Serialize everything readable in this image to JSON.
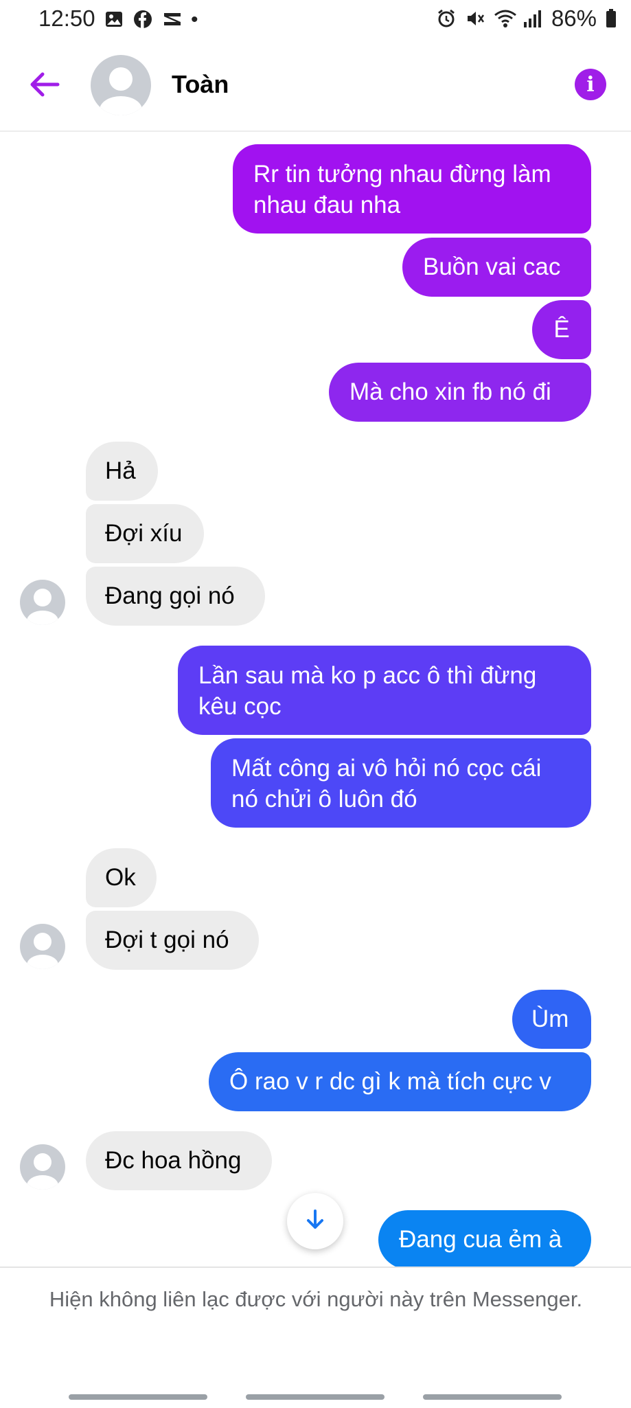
{
  "status_bar": {
    "time": "12:50",
    "battery": "86%",
    "icons": [
      "gallery-icon",
      "facebook-icon",
      "capcut-icon",
      "dot-icon",
      "alarm-icon",
      "mute-icon",
      "wifi-icon",
      "signal-icon",
      "battery-icon"
    ]
  },
  "header": {
    "contact_name": "Toàn",
    "info_glyph": "i",
    "accent_color": "#a01ee8"
  },
  "messages": [
    {
      "side": "out",
      "text": "Rr tin tưởng nhau đừng làm nhau đau nha",
      "color": "#a112f0"
    },
    {
      "side": "out",
      "text": "Buồn vai cac",
      "color": "#9b1cef"
    },
    {
      "side": "out",
      "text": "Ê",
      "color": "#9421ee"
    },
    {
      "side": "out",
      "text": "Mà cho xin fb nó đi",
      "color": "#8e27ee"
    },
    {
      "side": "in",
      "text": "Hả"
    },
    {
      "side": "in",
      "text": "Đợi xíu"
    },
    {
      "side": "in",
      "text": "Đang gọi nó"
    },
    {
      "side": "out",
      "text": "Lần sau mà ko p acc ô thì đừng kêu cọc",
      "color": "#5d3df5"
    },
    {
      "side": "out",
      "text": "Mất công ai vô hỏi nó cọc cái nó chửi ô luôn đó",
      "color": "#4d48f7"
    },
    {
      "side": "in",
      "text": "Ok"
    },
    {
      "side": "in",
      "text": "Đợi t gọi nó"
    },
    {
      "side": "out",
      "text": "Ùm",
      "color": "#2f64f5"
    },
    {
      "side": "out",
      "text": "Ô rao v r dc gì k mà tích cực v",
      "color": "#2a6cf3"
    },
    {
      "side": "in",
      "text": "Đc hoa hồng"
    },
    {
      "side": "out",
      "text": "Đang cua ẻm à",
      "color": "#0a84f2"
    }
  ],
  "scroll_down_icon": "arrow-down-icon",
  "footer": {
    "notice": "Hiện không liên lạc được với người này trên Messenger."
  }
}
